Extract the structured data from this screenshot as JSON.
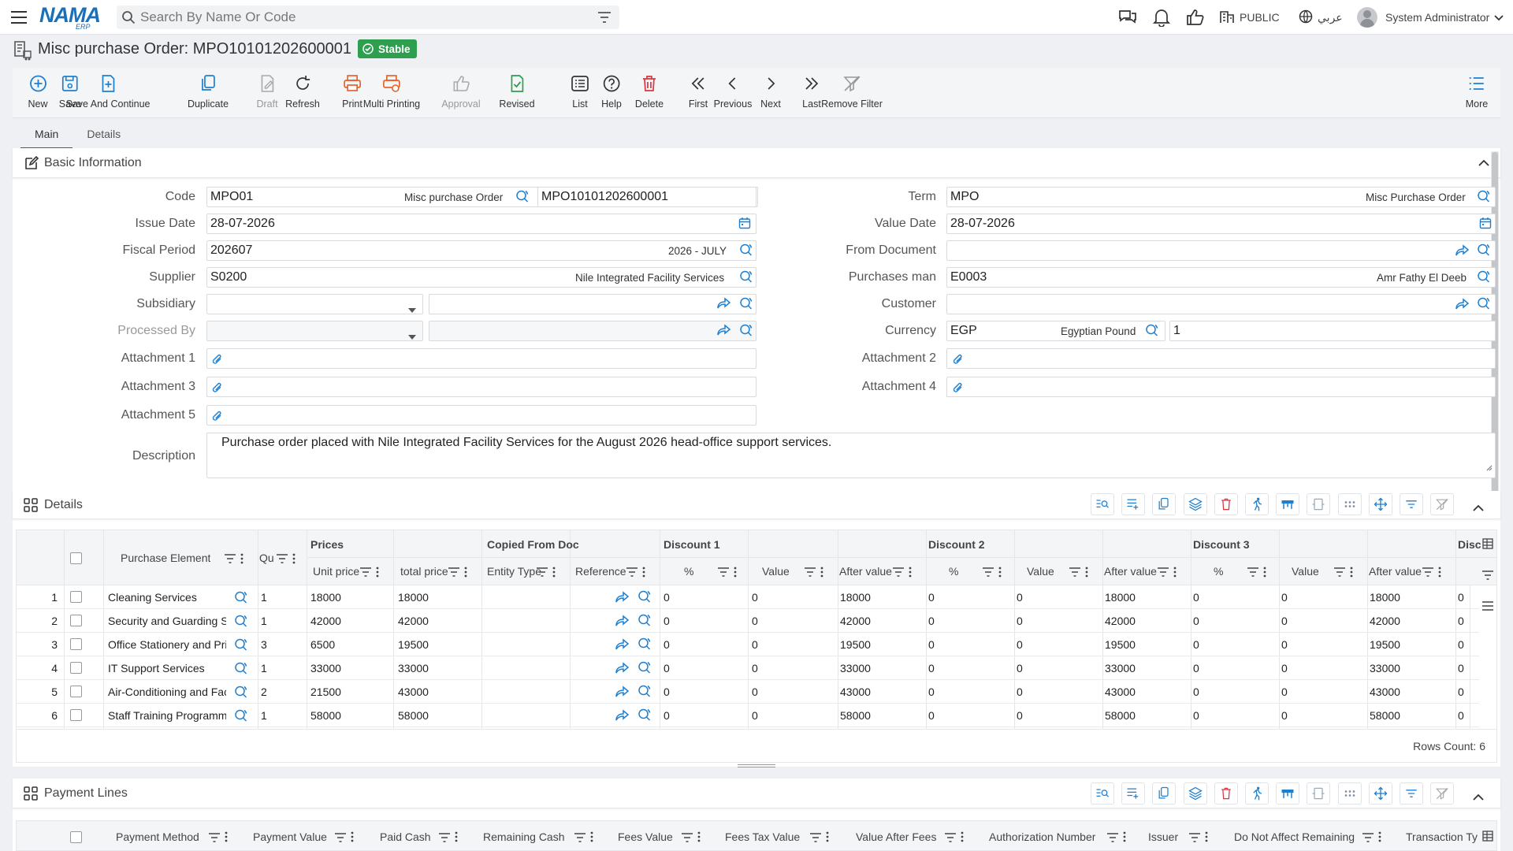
{
  "app": {
    "logo_text": "NAMA",
    "logo_sub": "ERP"
  },
  "topbar": {
    "search_placeholder": "Search By Name Or Code",
    "public_label": "PUBLIC",
    "lang_label": "عربي",
    "user_name": "System Administrator"
  },
  "page": {
    "title": "Misc purchase Order: MPO10101202600001",
    "status": "Stable"
  },
  "toolbar": [
    {
      "label": "New",
      "icon": "plus-circle-icon",
      "enabled": true
    },
    {
      "label": "Save",
      "icon": "save-icon",
      "enabled": true
    },
    {
      "label": "Save And Continue",
      "icon": "save-continue-icon",
      "enabled": true
    },
    {
      "label": "Duplicate",
      "icon": "duplicate-icon",
      "enabled": true
    },
    {
      "label": "Draft",
      "icon": "draft-icon",
      "enabled": false
    },
    {
      "label": "Refresh",
      "icon": "refresh-icon",
      "enabled": true
    },
    {
      "label": "Print",
      "icon": "print-icon",
      "enabled": true
    },
    {
      "label": "Multi Printing",
      "icon": "multi-print-icon",
      "enabled": true
    },
    {
      "label": "Approval",
      "icon": "thumbs-up-icon",
      "enabled": false
    },
    {
      "label": "Revised",
      "icon": "revised-icon",
      "enabled": true
    },
    {
      "label": "List",
      "icon": "list-icon",
      "enabled": true
    },
    {
      "label": "Help",
      "icon": "help-icon",
      "enabled": true
    },
    {
      "label": "Delete",
      "icon": "trash-icon",
      "enabled": true
    },
    {
      "label": "First",
      "icon": "first-icon",
      "enabled": true
    },
    {
      "label": "Previous",
      "icon": "previous-icon",
      "enabled": true
    },
    {
      "label": "Next",
      "icon": "next-icon",
      "enabled": true
    },
    {
      "label": "Last",
      "icon": "last-icon",
      "enabled": true
    },
    {
      "label": "Remove Filter",
      "icon": "remove-filter-icon",
      "enabled": true
    }
  ],
  "more_label": "More",
  "tabs": [
    "Main",
    "Details"
  ],
  "basic": {
    "title": "Basic Information",
    "code": {
      "label": "Code",
      "value": "MPO01",
      "name": "Misc purchase Order",
      "doc": "MPO10101202600001"
    },
    "issue_date": {
      "label": "Issue Date",
      "value": "28-07-2026"
    },
    "fiscal": {
      "label": "Fiscal Period",
      "value": "202607",
      "name": "2026 - JULY"
    },
    "supplier": {
      "label": "Supplier",
      "value": "S0200",
      "name": "Nile Integrated Facility Services"
    },
    "subsidiary": {
      "label": "Subsidiary"
    },
    "processed_by": {
      "label": "Processed By"
    },
    "att1": "Attachment 1",
    "att3": "Attachment 3",
    "att5": "Attachment 5",
    "att2": "Attachment 2",
    "att4": "Attachment 4",
    "term": {
      "label": "Term",
      "value": "MPO",
      "name": "Misc Purchase Order"
    },
    "value_date": {
      "label": "Value Date",
      "value": "28-07-2026"
    },
    "from_doc": {
      "label": "From Document"
    },
    "purchases_man": {
      "label": "Purchases man",
      "value": "E0003",
      "name": "Amr Fathy El Deeb"
    },
    "customer": {
      "label": "Customer"
    },
    "currency": {
      "label": "Currency",
      "value": "EGP",
      "name": "Egyptian Pound",
      "rate": "1"
    },
    "description": {
      "label": "Description",
      "value": "Purchase order placed with Nile Integrated Facility Services for the August 2026 head-office support services."
    }
  },
  "details": {
    "title": "Details",
    "groups": [
      "Prices",
      "Copied From Doc",
      "Discount 1",
      "Discount 2",
      "Discount 3",
      "Disc"
    ],
    "columns": [
      "Purchase Element",
      "Qu",
      "Unit price",
      "total price",
      "Entity Type",
      "Reference",
      "%",
      "Value",
      "After value",
      "%",
      "Value",
      "After value",
      "%",
      "Value",
      "After value"
    ],
    "rows": [
      {
        "n": "1",
        "element": "Cleaning Services",
        "qty": "1",
        "unit": "18000",
        "total": "18000",
        "d1p": "0",
        "d1v": "0",
        "d1a": "18000",
        "d2p": "0",
        "d2v": "0",
        "d2a": "18000",
        "d3p": "0",
        "d3v": "0",
        "d3a": "18000",
        "d4": "0"
      },
      {
        "n": "2",
        "element": "Security and Guarding S",
        "qty": "1",
        "unit": "42000",
        "total": "42000",
        "d1p": "0",
        "d1v": "0",
        "d1a": "42000",
        "d2p": "0",
        "d2v": "0",
        "d2a": "42000",
        "d3p": "0",
        "d3v": "0",
        "d3a": "42000",
        "d4": "0"
      },
      {
        "n": "3",
        "element": "Office Stationery and Pri",
        "qty": "3",
        "unit": "6500",
        "total": "19500",
        "d1p": "0",
        "d1v": "0",
        "d1a": "19500",
        "d2p": "0",
        "d2v": "0",
        "d2a": "19500",
        "d3p": "0",
        "d3v": "0",
        "d3a": "19500",
        "d4": "0"
      },
      {
        "n": "4",
        "element": "IT Support Services",
        "qty": "1",
        "unit": "33000",
        "total": "33000",
        "d1p": "0",
        "d1v": "0",
        "d1a": "33000",
        "d2p": "0",
        "d2v": "0",
        "d2a": "33000",
        "d3p": "0",
        "d3v": "0",
        "d3a": "33000",
        "d4": "0"
      },
      {
        "n": "5",
        "element": "Air-Conditioning and Fac",
        "qty": "2",
        "unit": "21500",
        "total": "43000",
        "d1p": "0",
        "d1v": "0",
        "d1a": "43000",
        "d2p": "0",
        "d2v": "0",
        "d2a": "43000",
        "d3p": "0",
        "d3v": "0",
        "d3a": "43000",
        "d4": "0"
      },
      {
        "n": "6",
        "element": "Staff Training Programm",
        "qty": "1",
        "unit": "58000",
        "total": "58000",
        "d1p": "0",
        "d1v": "0",
        "d1a": "58000",
        "d2p": "0",
        "d2v": "0",
        "d2a": "58000",
        "d3p": "0",
        "d3v": "0",
        "d3a": "58000",
        "d4": "0"
      }
    ],
    "rows_count": "Rows Count: 6"
  },
  "payment": {
    "title": "Payment Lines",
    "columns": [
      "Payment Method",
      "Payment Value",
      "Paid Cash",
      "Remaining Cash",
      "Fees Value",
      "Fees Tax Value",
      "Value After Fees",
      "Authorization Number",
      "Issuer",
      "Do Not Affect Remaining",
      "Transaction Ty"
    ]
  },
  "colors": {
    "accent": "#1a6e8c",
    "stable_badge": "#2e9e4f",
    "delete": "#d9363e",
    "print": "#e8622c",
    "blue_icon": "#1d7fd1"
  }
}
